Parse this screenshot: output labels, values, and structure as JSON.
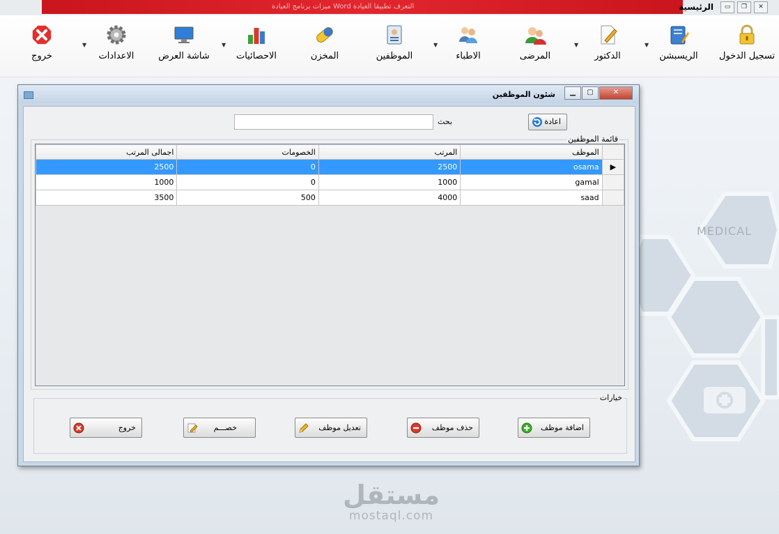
{
  "top_bar": {
    "title": "الرئيسية",
    "banner_text": "ميزات برنامج العيادة   Word   التعرف تطبيقا العيادة"
  },
  "menu": [
    {
      "label": "تسجيل الدخول",
      "icon": "lock-icon"
    },
    {
      "label": "الريسبشن",
      "icon": "notebook-icon"
    },
    {
      "label": "الدكتور",
      "icon": "edit-document-icon"
    },
    {
      "label": "المرضى",
      "icon": "patients-icon"
    },
    {
      "label": "الاطباء",
      "icon": "doctors-icon"
    },
    {
      "label": "الموظفين",
      "icon": "employees-book-icon"
    },
    {
      "label": "المخزن",
      "icon": "pill-icon"
    },
    {
      "label": "الاحصائيات",
      "icon": "bar-chart-icon"
    },
    {
      "label": "شاشة العرض",
      "icon": "monitor-icon"
    },
    {
      "label": "الاعدادات",
      "icon": "gear-icon"
    },
    {
      "label": "خروج",
      "icon": "exit-x-icon"
    }
  ],
  "window": {
    "title": "شئون الموظفين",
    "refresh_label": "اعادة",
    "search_label": "بحث",
    "search_value": "",
    "list_group_label": "قائمة الموظفين",
    "options_group_label": "خيارات",
    "columns": [
      "الموظف",
      "المرتب",
      "الخصومات",
      "اجمالى المرتب"
    ],
    "rows": [
      {
        "name": "osama",
        "salary": "2500",
        "deductions": "0",
        "total": "2500"
      },
      {
        "name": "gamal",
        "salary": "1000",
        "deductions": "0",
        "total": "1000"
      },
      {
        "name": "saad",
        "salary": "4000",
        "deductions": "500",
        "total": "3500"
      }
    ],
    "buttons": {
      "add": "اضافة موظف",
      "delete": "حذف موظف",
      "edit": "تعديل موظف",
      "deduct": "خصـــم",
      "exit": "خروج"
    }
  },
  "background": {
    "medical_text": "MEDICAL",
    "watermark_logo": "مستقل",
    "watermark_url": "mostaql.com"
  }
}
